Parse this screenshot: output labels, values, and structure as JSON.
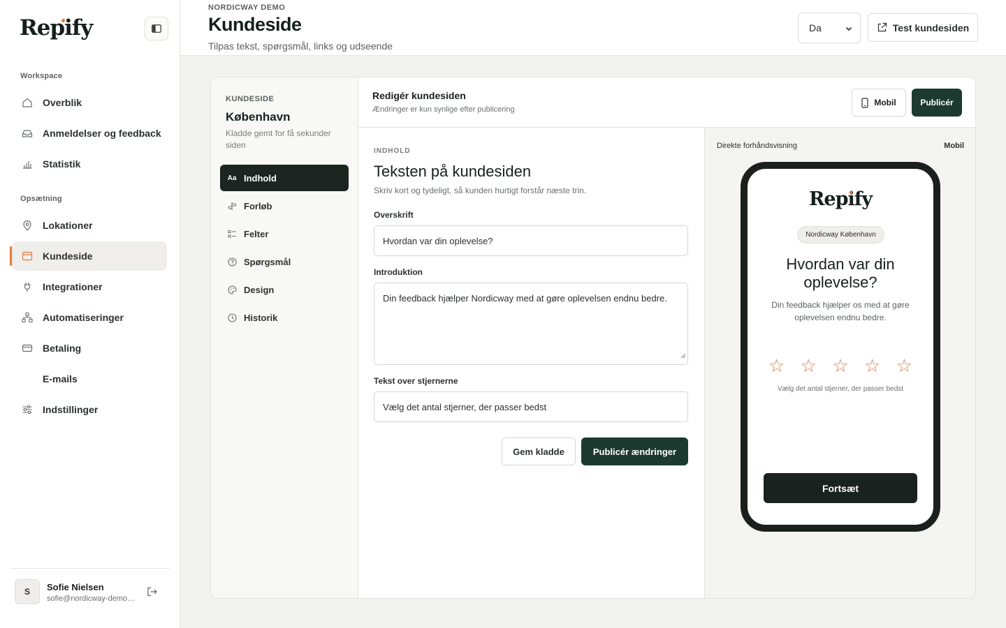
{
  "app": {
    "logo": "Repify"
  },
  "sidebar": {
    "sections": [
      {
        "label": "Workspace"
      },
      {
        "label": "Opsætning"
      }
    ],
    "items": [
      {
        "label": "Overblik",
        "icon": "home-icon"
      },
      {
        "label": "Anmeldelser og feedback",
        "icon": "inbox-icon"
      },
      {
        "label": "Statistik",
        "icon": "bar-chart-icon"
      },
      {
        "label": "Lokationer",
        "icon": "map-pin-icon"
      },
      {
        "label": "Kundeside",
        "icon": "browser-icon",
        "active": true
      },
      {
        "label": "Integrationer",
        "icon": "plug-icon"
      },
      {
        "label": "Automatiseringer",
        "icon": "workflow-icon"
      },
      {
        "label": "Betaling",
        "icon": "credit-card-icon"
      },
      {
        "label": "E-mails",
        "icon": ""
      },
      {
        "label": "Indstillinger",
        "icon": "sliders-icon"
      }
    ],
    "user": {
      "initial": "S",
      "name": "Sofie Nielsen",
      "email": "sofie@nordicway-demo.com"
    }
  },
  "header": {
    "breadcrumb": "NORDICWAY DEMO",
    "title": "Kundeside",
    "subtitle": "Tilpas tekst, spørgsmål, links og udseende",
    "language": "Da",
    "test_button": "Test kundesiden"
  },
  "subnav": {
    "label": "KUNDESIDE",
    "title": "København",
    "note": "Kladde gemt for få sekunder siden",
    "items": [
      {
        "label": "Indhold",
        "icon": "text-icon",
        "active": true
      },
      {
        "label": "Forløb",
        "icon": "signpost-icon"
      },
      {
        "label": "Felter",
        "icon": "list-icon"
      },
      {
        "label": "Spørgsmål",
        "icon": "question-icon"
      },
      {
        "label": "Design",
        "icon": "palette-icon"
      },
      {
        "label": "Historik",
        "icon": "clock-icon"
      }
    ]
  },
  "toolbar": {
    "title": "Redigér kundesiden",
    "subtitle": "Ændringer er kun synlige efter publicering",
    "mobile_button": "Mobil",
    "publish_button": "Publicér"
  },
  "editor": {
    "section_label": "INDHOLD",
    "title": "Teksten på kundesiden",
    "subtitle": "Skriv kort og tydeligt, så kunden hurtigt forstår næste trin.",
    "fields": {
      "heading": {
        "label": "Overskrift",
        "value": "Hvordan var din oplevelse?"
      },
      "intro": {
        "label": "Introduktion",
        "value": "Din feedback hjælper Nordicway med at gøre oplevelsen endnu bedre."
      },
      "stars_text": {
        "label": "Tekst over stjernerne",
        "value": "Vælg det antal stjerner, der passer bedst"
      }
    },
    "save_draft": "Gem kladde",
    "publish_changes": "Publicér ændringer"
  },
  "preview": {
    "label": "Direkte forhåndsvisning",
    "mode": "Mobil",
    "logo": "Repify",
    "badge": "Nordicway København",
    "title": "Hvordan var din oplevelse?",
    "intro": "Din feedback hjælper os med at gøre oplevelsen endnu bedre.",
    "stars_text": "Vælg det antal stjerner, der passer bedst",
    "star_count": 5,
    "continue": "Fortsæt"
  },
  "colors": {
    "accent": "#e2793b",
    "primary": "#1d3a30",
    "dark": "#1a221f"
  }
}
